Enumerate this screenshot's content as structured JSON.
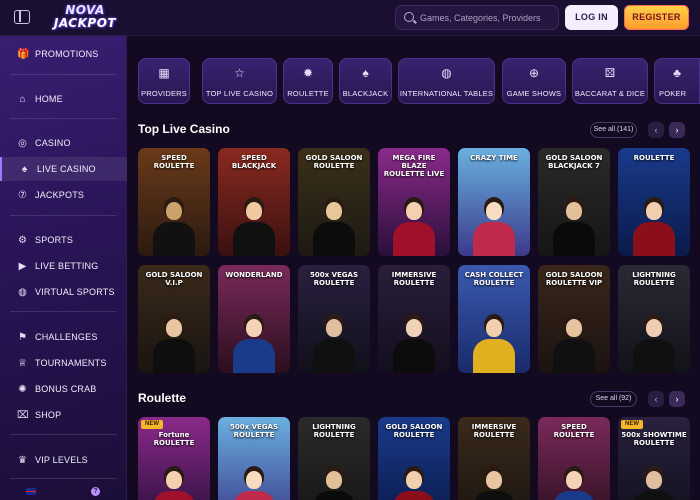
{
  "header": {
    "logo_line1": "NOVA",
    "logo_line2": "JACKPOT",
    "search_placeholder": "Games, Categories, Providers",
    "login_label": "LOG IN",
    "register_label": "REGISTER"
  },
  "sidebar": {
    "items": [
      {
        "label": "PROMOTIONS",
        "icon": "gift-icon",
        "glyph": "🎁"
      },
      {
        "label": "HOME",
        "icon": "home-icon",
        "glyph": "⌂"
      },
      {
        "label": "CASINO",
        "icon": "casino-chip-icon",
        "glyph": "◎"
      },
      {
        "label": "LIVE CASINO",
        "icon": "live-casino-icon",
        "glyph": "♠"
      },
      {
        "label": "JACKPOTS",
        "icon": "jackpot-icon",
        "glyph": "⑦"
      },
      {
        "label": "SPORTS",
        "icon": "sports-icon",
        "glyph": "⚙"
      },
      {
        "label": "LIVE BETTING",
        "icon": "live-betting-icon",
        "glyph": "▶"
      },
      {
        "label": "VIRTUAL SPORTS",
        "icon": "virtual-sports-icon",
        "glyph": "◍"
      },
      {
        "label": "CHALLENGES",
        "icon": "challenges-icon",
        "glyph": "⚑"
      },
      {
        "label": "TOURNAMENTS",
        "icon": "trophy-icon",
        "glyph": "♕"
      },
      {
        "label": "BONUS CRAB",
        "icon": "bonus-crab-icon",
        "glyph": "✺"
      },
      {
        "label": "SHOP",
        "icon": "shop-icon",
        "glyph": "⌧"
      },
      {
        "label": "VIP LEVELS",
        "icon": "vip-crown-icon",
        "glyph": "♛"
      }
    ],
    "help_glyph": "?"
  },
  "categories": [
    {
      "label": "PROVIDERS",
      "glyph": "▦"
    },
    {
      "label": "TOP LIVE CASINO",
      "glyph": "☆"
    },
    {
      "label": "ROULETTE",
      "glyph": "✹"
    },
    {
      "label": "BLACKJACK",
      "glyph": "♠"
    },
    {
      "label": "INTERNATIONAL TABLES",
      "glyph": "◍"
    },
    {
      "label": "GAME SHOWS",
      "glyph": "⊕"
    },
    {
      "label": "BACCARAT & DICE",
      "glyph": "⚄"
    },
    {
      "label": "POKER",
      "glyph": "♣"
    }
  ],
  "sections": [
    {
      "title": "Top Live Casino",
      "see_all": "See all (141)",
      "prev": "‹",
      "next": "›",
      "tiles": [
        {
          "title": "SPEED ROULETTE"
        },
        {
          "title": "SPEED BLACKJACK"
        },
        {
          "title": "GOLD SALOON ROULETTE"
        },
        {
          "title": "MEGA FIRE BLAZE ROULETTE LIVE"
        },
        {
          "title": "CRAZY TIME"
        },
        {
          "title": "GOLD SALOON BLACKJACK 7"
        },
        {
          "title": "ROULETTE"
        },
        {
          "title": "GOLD SALOON V.I.P"
        },
        {
          "title": "WONDERLAND"
        },
        {
          "title": "500x VEGAS ROULETTE"
        },
        {
          "title": "IMMERSIVE ROULETTE"
        },
        {
          "title": "CASH COLLECT ROULETTE"
        },
        {
          "title": "GOLD SALOON ROULETTE VIP"
        },
        {
          "title": "LIGHTNING ROULETTE"
        }
      ]
    },
    {
      "title": "Roulette",
      "see_all": "See all (92)",
      "prev": "‹",
      "next": "›",
      "tiles": [
        {
          "title": "Fortune ROULETTE",
          "badge": "NEW"
        },
        {
          "title": "500x VEGAS ROULETTE"
        },
        {
          "title": "LIGHTNING ROULETTE"
        },
        {
          "title": "GOLD SALOON ROULETTE"
        },
        {
          "title": "IMMERSIVE ROULETTE"
        },
        {
          "title": "SPEED ROULETTE"
        },
        {
          "title": "500x SHOWTIME ROULETTE",
          "badge": "NEW"
        }
      ]
    }
  ],
  "colors": {
    "background": "#130a22",
    "sidebar_top": "#3a1e72",
    "accent_register": "#ffb83a",
    "accent_login": "#f6edff"
  }
}
